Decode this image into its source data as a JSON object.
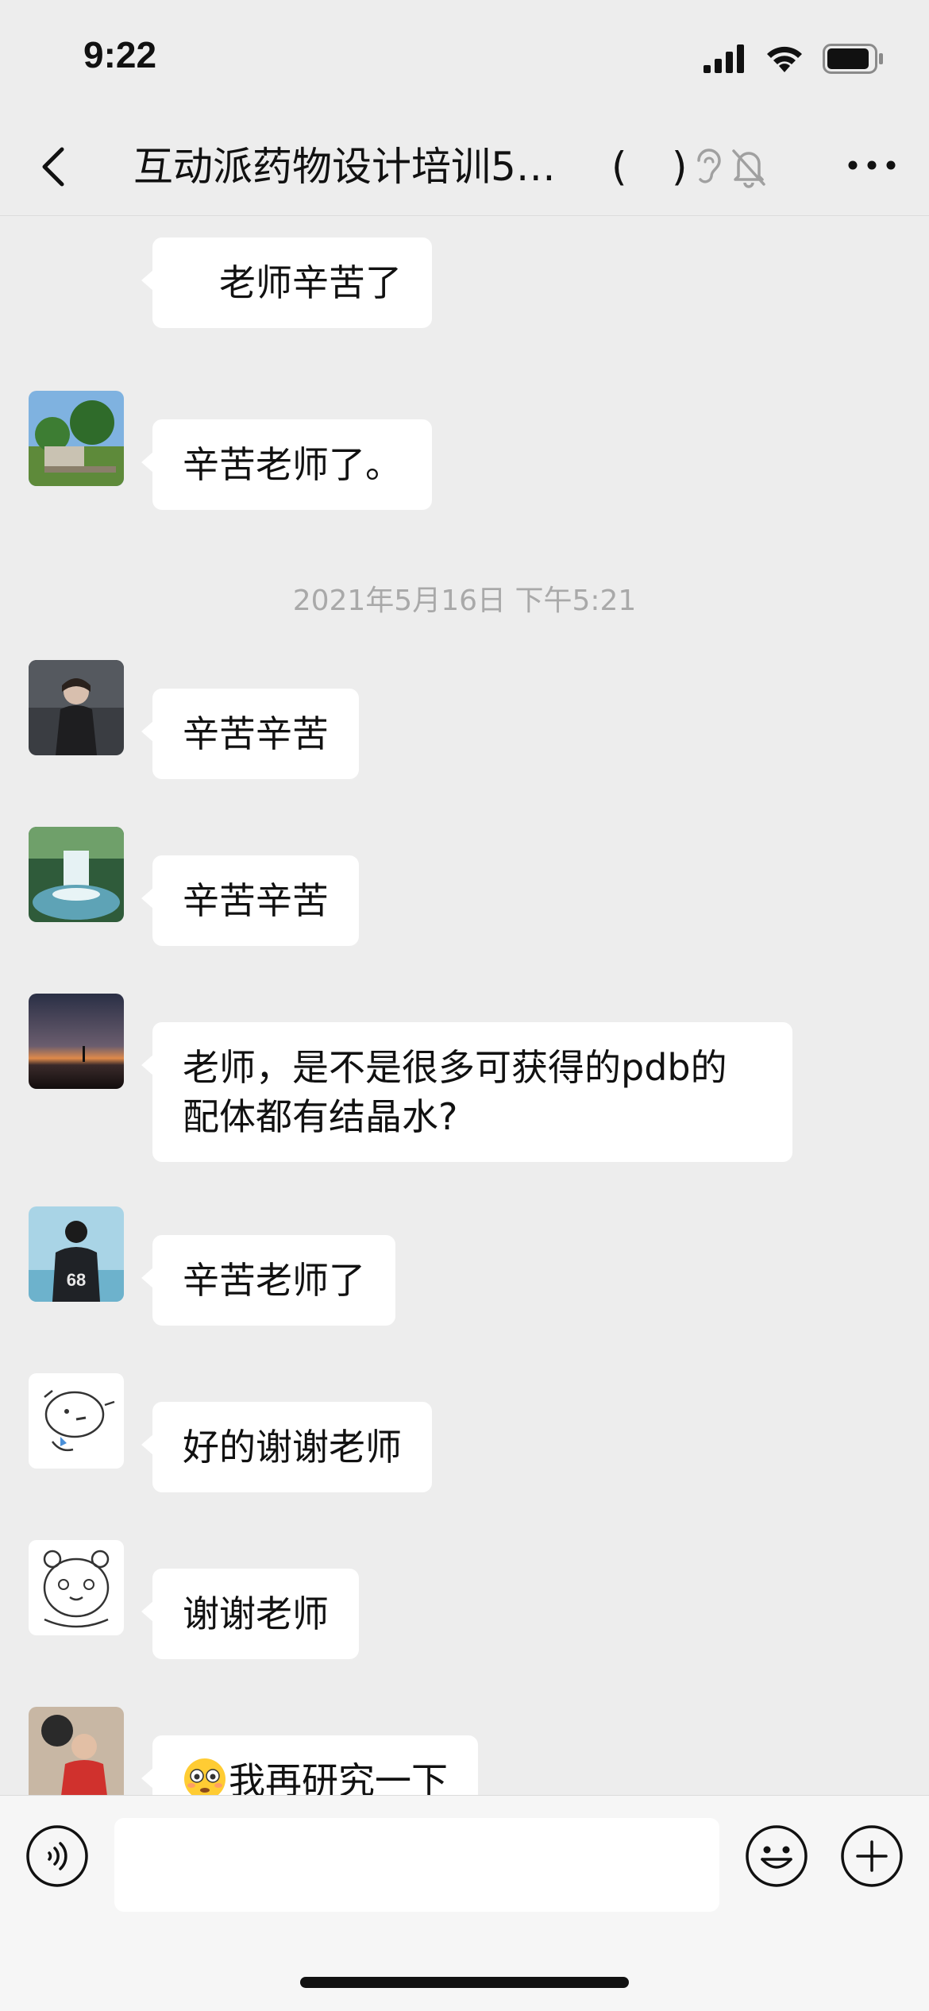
{
  "status_bar": {
    "time": "9:22"
  },
  "nav": {
    "title": "互动派药物设计培训5…",
    "paren_open": "(",
    "paren_close": ")"
  },
  "messages": [
    {
      "text": "老师辛苦了",
      "has_avatar": false
    },
    {
      "text": "辛苦老师了。",
      "avatar": "avatar-landscape-tree"
    },
    {
      "timestamp": "2021年5月16日 下午5:21"
    },
    {
      "text": "辛苦辛苦",
      "avatar": "avatar-person-dark"
    },
    {
      "text": "辛苦辛苦",
      "avatar": "avatar-waterfall"
    },
    {
      "text": "老师，是不是很多可获得的pdb的配体都有结晶水?",
      "avatar": "avatar-sunset"
    },
    {
      "text": "辛苦老师了",
      "avatar": "avatar-sport-68"
    },
    {
      "text": "好的谢谢老师",
      "avatar": "avatar-cartoon-dog"
    },
    {
      "text": "谢谢老师",
      "avatar": "avatar-cartoon-bear"
    },
    {
      "text": "我再研究一下",
      "avatar": "avatar-red-child",
      "emoji": "flushed-face-icon"
    }
  ],
  "input": {
    "value": "",
    "placeholder": ""
  },
  "colors": {
    "background": "#ededed",
    "bubble": "#ffffff",
    "timestamp": "#a9a9a9"
  }
}
